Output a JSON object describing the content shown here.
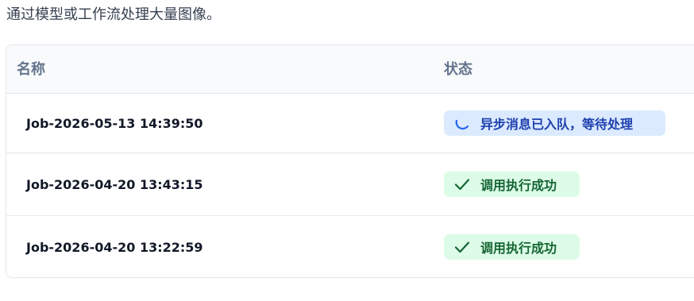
{
  "description": "通过模型或工作流处理大量图像。",
  "table": {
    "columns": {
      "name": "名称",
      "status": "状态"
    },
    "rows": [
      {
        "name": "Job-2026-05-13 14:39:50",
        "status": "异步消息已入队，等待处理",
        "status_type": "queued",
        "icon": "spinner-icon"
      },
      {
        "name": "Job-2026-04-20 13:43:15",
        "status": "调用执行成功",
        "status_type": "success",
        "icon": "check-icon"
      },
      {
        "name": "Job-2026-04-20 13:22:59",
        "status": "调用执行成功",
        "status_type": "success",
        "icon": "check-icon"
      }
    ]
  },
  "colors": {
    "queued_bg": "#dbeafe",
    "queued_text": "#1e40af",
    "success_bg": "#dcfce7",
    "success_text": "#166534",
    "header_bg": "#f8fafc",
    "header_text": "#64748b"
  }
}
